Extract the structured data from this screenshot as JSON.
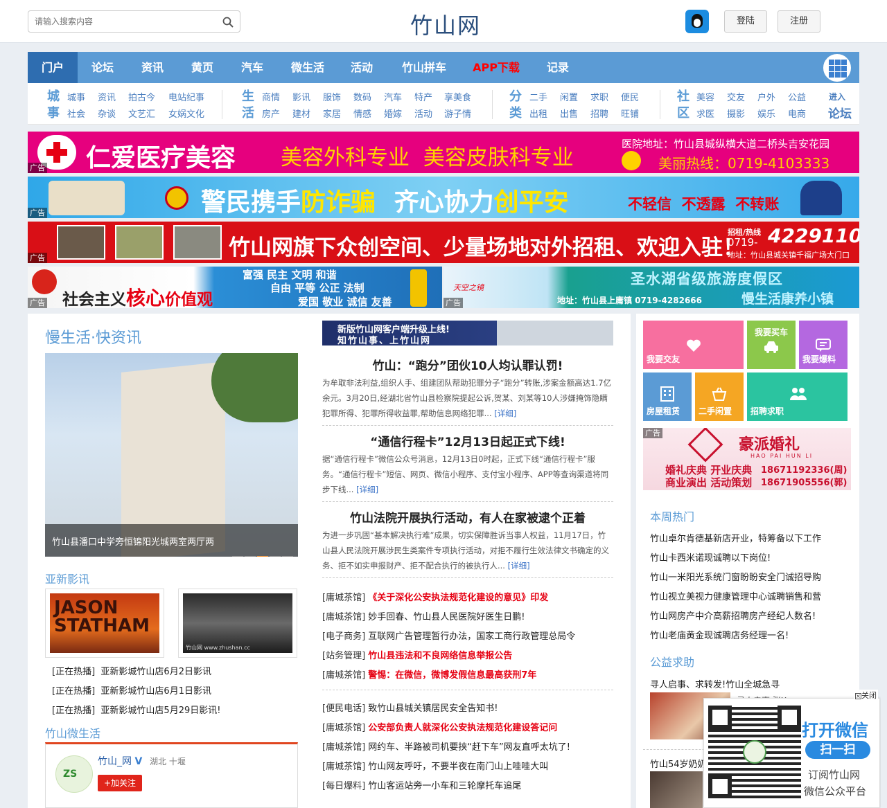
{
  "header": {
    "search_placeholder": "请输入搜索内容",
    "logo": "竹山网",
    "login": "登陆",
    "register": "注册"
  },
  "nav": {
    "items": [
      "门户",
      "论坛",
      "资讯",
      "黄页",
      "汽车",
      "微生活",
      "活动",
      "竹山拼车",
      "APP下载",
      "记录"
    ]
  },
  "subnav": {
    "g1": {
      "big": [
        "城",
        "事"
      ],
      "row1": [
        "城事",
        "资讯",
        "拍古今",
        "电站纪事"
      ],
      "row2": [
        "社会",
        "杂谈",
        "文艺汇",
        "女娲文化"
      ]
    },
    "g2": {
      "big": [
        "生",
        "活"
      ],
      "row1": [
        "商情",
        "影讯",
        "服饰",
        "数码",
        "汽车",
        "特产",
        "享美食"
      ],
      "row2": [
        "房产",
        "建材",
        "家居",
        "情感",
        "婚嫁",
        "活动",
        "游子情"
      ]
    },
    "g3": {
      "big": [
        "分",
        "类"
      ],
      "row1": [
        "二手",
        "闲置",
        "求职",
        "便民"
      ],
      "row2": [
        "出租",
        "出售",
        "招聘",
        "旺铺"
      ]
    },
    "g4": {
      "big": [
        "社",
        "区"
      ],
      "row1": [
        "美容",
        "交友",
        "户外",
        "公益"
      ],
      "row2": [
        "求医",
        "摄影",
        "娱乐",
        "电商"
      ]
    },
    "enter": [
      "进入",
      "论坛"
    ]
  },
  "ads": {
    "tag": "广告",
    "ad1": {
      "title": "仁爱医疗美容",
      "mid": "美容外科专业  美容皮肤科专业",
      "addr": "医院地址：竹山县城纵横大道二桥头吉安花园",
      "phone": "美丽热线：0719-4103333"
    },
    "ad2": {
      "a": "警民携手",
      "b": "防诈骗",
      "c": "齐心协力",
      "d": "创平安",
      "e": "不轻信  不透露  不转账"
    },
    "ad3": {
      "title": "竹山网旗下众创空间、少量场地对外招租、欢迎入驻！",
      "hotline_label": "招租/热线",
      "area": "0719-",
      "phone": "4229110",
      "addr": "地址：竹山县城关镇千福广场大门口"
    },
    "ad4": {
      "a": "社会主义",
      "b": "核心",
      "c": "价值观",
      "l1": "富强 民主 文明 和谐",
      "l2": "自由 平等 公正 法制",
      "l3": "爱国 敬业 诚信 友善"
    },
    "ad5": {
      "logo": "天空之镜",
      "title": "圣水湖省级旅游度假区",
      "sub": "慢生活康养小镇",
      "addr": "地址：竹山县上庸镇  0719-4282666"
    }
  },
  "left": {
    "section_title": "慢生活·快资讯",
    "slide_caption": "竹山县潘口中学旁恒锦阳光城两室两厅两",
    "movie_title": "亚新影讯",
    "movie_poster1": "JASON STATHAM",
    "movie_poster2": "竹山网 www.zhushan.cc",
    "movies": [
      {
        "cat": "[正在热播]",
        "txt": "亚新影城竹山店6月2日影讯"
      },
      {
        "cat": "[正在热播]",
        "txt": "亚新影城竹山店6月1日影讯"
      },
      {
        "cat": "[正在热播]",
        "txt": "亚新影城竹山店5月29日影讯!"
      }
    ],
    "weibo_title": "竹山微生活",
    "weibo_name": "竹山_网",
    "weibo_loc": "湖北 十堰",
    "follow": "+加关注"
  },
  "middle": {
    "banner_l1": "新版竹山网客户端升级上线!",
    "banner_l2": "知竹山事、上竹山网",
    "news": [
      {
        "title": "竹山：“跑分”团伙10人均认罪认罚!",
        "body": "为牟取非法利益,组织人手、组建团队帮助犯罪分子“跑分”转账,涉案金额高达1.7亿余元。3月20日,经湖北省竹山县检察院提起公诉,贺某、刘某等10人涉嫌掩饰隐瞒犯罪所得、犯罪所得收益罪,帮助信息网络犯罪...",
        "more": "[详细]"
      },
      {
        "title": "“通信行程卡”12月13日起正式下线!",
        "body": "据“通信行程卡”微信公众号消息，12月13日0时起，正式下线“通信行程卡”服务。“通信行程卡”短信、网页、微信小程序、支付宝小程序、APP等查询渠道将同步下线...",
        "more": "[详细]"
      },
      {
        "title": "竹山法院开展执行活动，有人在家被逮个正着",
        "body": "为进一步巩固“基本解决执行难”成果，切实保障胜诉当事人权益，11月17日，竹山县人民法院开展涉民生类案件专项执行活动，对拒不履行生效法律文书确定的义务、拒不如实申报财产、拒不配合执行的被执行人...",
        "more": "[详细]"
      }
    ],
    "list1": [
      {
        "cat": "[庸城茶馆]",
        "txt": "《关于深化公安执法规范化建设的意见》印发",
        "red": true
      },
      {
        "cat": "[庸城茶馆]",
        "txt": "妙手回春、竹山县人民医院好医生日鹏!",
        "red": false
      },
      {
        "cat": "[电子商务]",
        "txt": "互联网广告管理暂行办法，国家工商行政管理总局令",
        "red": false
      },
      {
        "cat": "[站务管理]",
        "txt": "竹山县违法和不良网络信息举报公告",
        "red": true
      },
      {
        "cat": "[庸城茶馆]",
        "txt": "警惕：在微信，微博发假信息最高获刑7年",
        "red": true
      }
    ],
    "list2": [
      {
        "cat": "[便民电话]",
        "txt": "致竹山县城关镇居民安全告知书!",
        "red": false
      },
      {
        "cat": "[庸城茶馆]",
        "txt": "公安部负责人就深化公安执法规范化建设答记问",
        "red": true
      },
      {
        "cat": "[庸城茶馆]",
        "txt": "网约车、半路被司机要挟“赶下车”网友直呼太坑了!",
        "red": false
      },
      {
        "cat": "[庸城茶馆]",
        "txt": "竹山网友呼吁，不要半夜在南门山上哇哇大叫",
        "red": false
      },
      {
        "cat": "[每日爆料]",
        "txt": "竹山客运站旁一小车和三轮摩托车追尾",
        "red": false
      }
    ]
  },
  "right": {
    "tiles": [
      "我要交友",
      "我要买车",
      "我要爆料",
      "房屋租赁",
      "二手闲置",
      "招聘求职"
    ],
    "tile_colors": [
      "#f76f9f",
      "#8cc84b",
      "#b468e0",
      "#5b9bd5",
      "#f5a623",
      "#2bc4a0"
    ],
    "wedding_ad": {
      "name": "豪派婚礼",
      "pinyin": "HAO PAI HUN LI",
      "l1": "婚礼庆典 开业庆典",
      "l2": "商业演出 活动策划",
      "p1": "18671192336(周)",
      "p2": "18671905556(郭)"
    },
    "hot_title": "本周热门",
    "hot": [
      "竹山卓尔肯德基新店开业，特筹备以下工作",
      "竹山卡西米诺现诚聘以下岗位!",
      "竹山一米阳光系统门窗盼盼安全门诚招导购",
      "竹山视立美视力健康管理中心诚聘销售和营",
      "竹山网房产中介高薪招聘房产经纪人数名!",
      "竹山老庙黄金现诚聘店务经理一名!"
    ],
    "charity_title": "公益求助",
    "charity": [
      "寻人启事、求转发!竹山全城急寻"
    ],
    "charity2": "竹山54岁奶奶",
    "charity_side": "寻人启事 张X"
  },
  "float_qr": {
    "close": "关闭",
    "open": "打开微信",
    "scan": "扫一扫",
    "sub1": "订阅竹山网",
    "sub2": "微信公众平台"
  }
}
